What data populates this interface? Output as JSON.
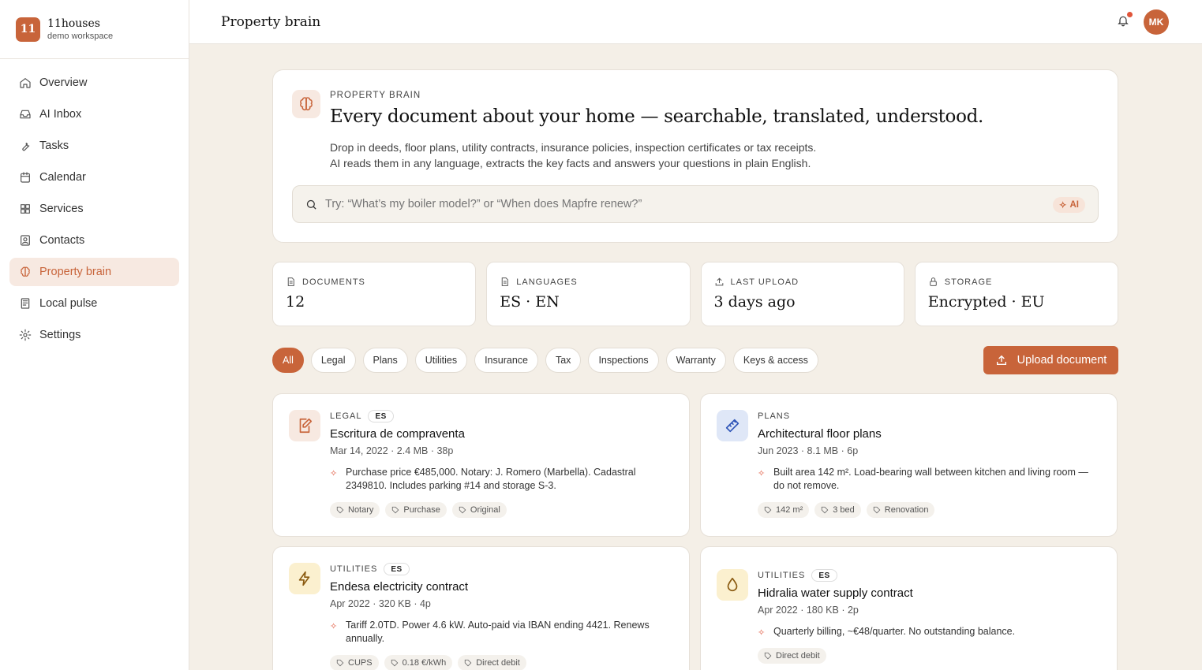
{
  "brand": {
    "logo": "11",
    "name": "11houses",
    "workspace": "demo workspace"
  },
  "nav": [
    {
      "label": "Overview",
      "icon": "home-icon"
    },
    {
      "label": "AI Inbox",
      "icon": "inbox-icon"
    },
    {
      "label": "Tasks",
      "icon": "wrench-icon"
    },
    {
      "label": "Calendar",
      "icon": "calendar-icon"
    },
    {
      "label": "Services",
      "icon": "grid-icon"
    },
    {
      "label": "Contacts",
      "icon": "contact-icon"
    },
    {
      "label": "Property brain",
      "icon": "brain-icon",
      "active": true
    },
    {
      "label": "Local pulse",
      "icon": "newspaper-icon"
    },
    {
      "label": "Settings",
      "icon": "gear-icon"
    }
  ],
  "topbar": {
    "title": "Property brain",
    "avatar": "MK"
  },
  "hero": {
    "eyebrow": "PROPERTY BRAIN",
    "title": "Every document about your home — searchable, translated, understood.",
    "desc_line1": "Drop in deeds, floor plans, utility contracts, insurance policies, inspection certificates or tax receipts.",
    "desc_line2": "AI reads them in any language, extracts the key facts and answers your questions in plain English.",
    "search_placeholder": "Try: “What’s my boiler model?” or “When does Mapfre renew?”",
    "ai_badge": "AI"
  },
  "stats": [
    {
      "label": "DOCUMENTS",
      "value": "12",
      "icon": "document-icon"
    },
    {
      "label": "LANGUAGES",
      "value": "ES · EN",
      "icon": "document-icon"
    },
    {
      "label": "LAST UPLOAD",
      "value": "3 days ago",
      "icon": "upload-icon"
    },
    {
      "label": "STORAGE",
      "value": "Encrypted · EU",
      "icon": "lock-icon"
    }
  ],
  "filters": [
    "All",
    "Legal",
    "Plans",
    "Utilities",
    "Insurance",
    "Tax",
    "Inspections",
    "Warranty",
    "Keys & access"
  ],
  "upload_label": "Upload document",
  "cards": [
    {
      "category": "LEGAL",
      "lang": "ES",
      "title": "Escritura de compraventa",
      "meta": "Mar 14, 2022 · 2.4 MB · 38p",
      "summary": "Purchase price €485,000. Notary: J. Romero (Marbella). Cadastral 2349810. Includes parking #14 and storage S-3.",
      "tags": [
        "Notary",
        "Purchase",
        "Original"
      ],
      "icon": "signature-icon",
      "icon_bg": "#f7e9e1",
      "icon_color": "#c8643a"
    },
    {
      "category": "PLANS",
      "lang": "",
      "title": "Architectural floor plans",
      "meta": "Jun 2023 · 8.1 MB · 6p",
      "summary": "Built area 142 m². Load-bearing wall between kitchen and living room — do not remove.",
      "tags": [
        "142 m²",
        "3 bed",
        "Renovation"
      ],
      "icon": "ruler-icon",
      "icon_bg": "#dfe7f7",
      "icon_color": "#2f55b8"
    },
    {
      "category": "UTILITIES",
      "lang": "ES",
      "title": "Endesa electricity contract",
      "meta": "Apr 2022 · 320 KB · 4p",
      "summary": "Tariff 2.0TD. Power 4.6 kW. Auto-paid via IBAN ending 4421. Renews annually.",
      "tags": [
        "CUPS",
        "0.18 €/kWh",
        "Direct debit"
      ],
      "icon": "bolt-icon",
      "icon_bg": "#fbf0cf",
      "icon_color": "#8a5a10"
    },
    {
      "category": "UTILITIES",
      "lang": "ES",
      "title": "Hidralia water supply contract",
      "meta": "Apr 2022 · 180 KB · 2p",
      "summary": "Quarterly billing, ~€48/quarter. No outstanding balance.",
      "tags": [
        "Direct debit"
      ],
      "icon": "droplet-icon",
      "icon_bg": "#fbf0cf",
      "icon_color": "#8a5a10"
    }
  ]
}
